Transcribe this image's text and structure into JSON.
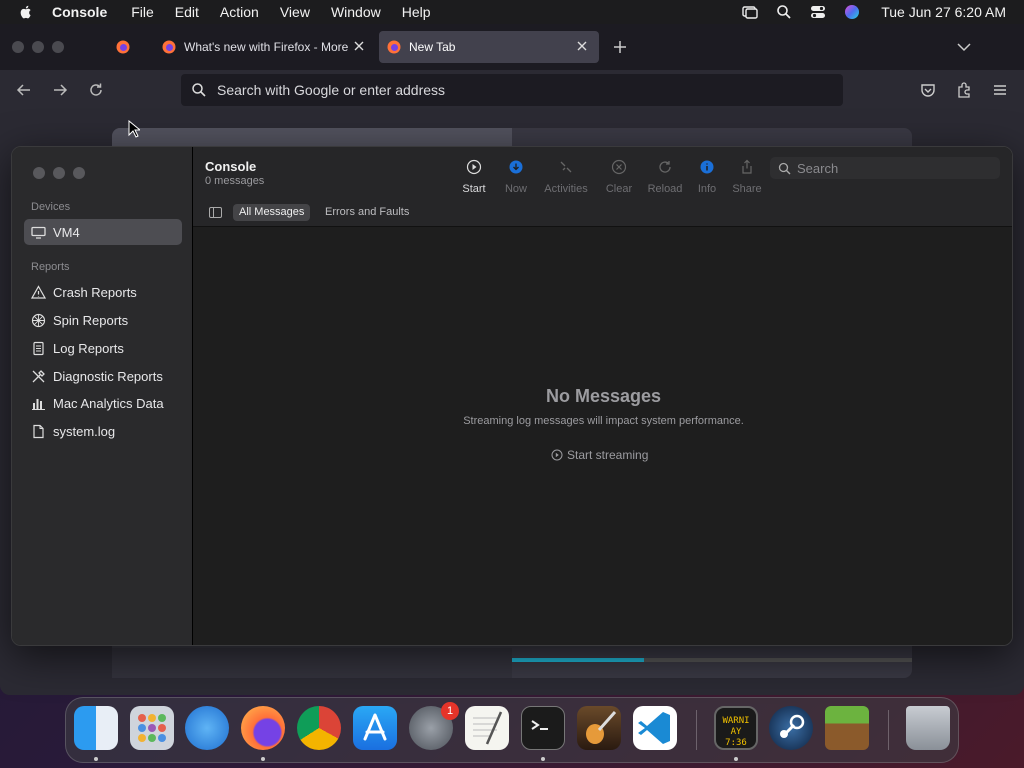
{
  "menubar": {
    "app": "Console",
    "items": [
      "File",
      "Edit",
      "Action",
      "View",
      "Window",
      "Help"
    ],
    "clock": "Tue Jun 27  6:20 AM"
  },
  "firefox": {
    "tabs": [
      {
        "title": "What's new with Firefox - More"
      },
      {
        "title": "New Tab"
      }
    ],
    "urlbar_placeholder": "Search with Google or enter address"
  },
  "console": {
    "title": "Console",
    "subtitle": "0 messages",
    "sidebar": {
      "devices_header": "Devices",
      "device": "VM4",
      "reports_header": "Reports",
      "reports": [
        {
          "label": "Crash Reports",
          "icon": "warning-icon"
        },
        {
          "label": "Spin Reports",
          "icon": "spin-icon"
        },
        {
          "label": "Log Reports",
          "icon": "document-icon"
        },
        {
          "label": "Diagnostic Reports",
          "icon": "tools-icon"
        },
        {
          "label": "Mac Analytics Data",
          "icon": "chart-icon"
        },
        {
          "label": "system.log",
          "icon": "file-icon"
        }
      ]
    },
    "toolbar": {
      "start": "Start",
      "now": "Now",
      "activities": "Activities",
      "clear": "Clear",
      "reload": "Reload",
      "info": "Info",
      "share": "Share",
      "search_placeholder": "Search"
    },
    "filters": {
      "all": "All Messages",
      "errors": "Errors and Faults"
    },
    "empty": {
      "title": "No Messages",
      "subtitle": "Streaming log messages will impact system performance.",
      "action": "Start streaming"
    }
  },
  "dock": {
    "settings_badge": "1",
    "console_icon_text_1": "WARNI",
    "console_icon_text_2": "AY 7:36"
  },
  "colors": {
    "accent": "#1fb6d6",
    "badge": "#e5342a",
    "blue": "#1a6fd8"
  }
}
